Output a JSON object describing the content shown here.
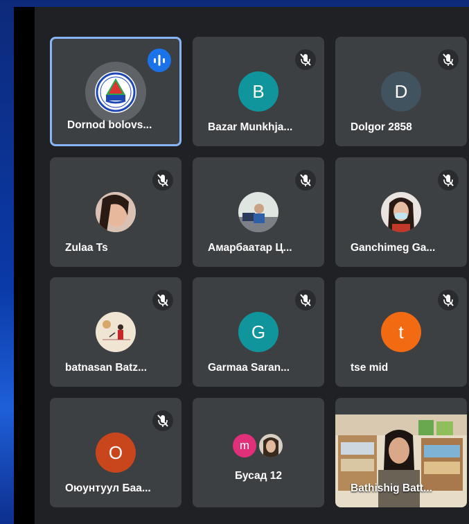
{
  "participants": [
    {
      "name": "Dornod bolovs...",
      "initial": "",
      "color": "",
      "muted": false,
      "talking": true
    },
    {
      "name": "Bazar Munkhja...",
      "initial": "B",
      "color": "#11959c",
      "muted": true
    },
    {
      "name": "Dolgor 2858",
      "initial": "D",
      "color": "#40535e",
      "muted": true
    },
    {
      "name": "Zulaa Ts",
      "initial": "",
      "color": "",
      "muted": true
    },
    {
      "name": "Амарбаатар Ц...",
      "initial": "",
      "color": "",
      "muted": true
    },
    {
      "name": "Ganchimeg Ga...",
      "initial": "",
      "color": "",
      "muted": true
    },
    {
      "name": "batnasan Batz...",
      "initial": "",
      "color": "",
      "muted": true
    },
    {
      "name": "Garmaa Saran...",
      "initial": "G",
      "color": "#11959c",
      "muted": true
    },
    {
      "name": "tse mid",
      "initial": "t",
      "color": "#f26a12",
      "muted": true
    },
    {
      "name": "Оюунтуул Баа...",
      "initial": "O",
      "color": "#c9451b",
      "muted": true
    },
    {
      "name": "Бусад 12",
      "initial": "m",
      "color": "#e0307a",
      "muted": false
    },
    {
      "name": "Bathishig Batt...",
      "initial": "",
      "color": "",
      "muted": false
    }
  ]
}
